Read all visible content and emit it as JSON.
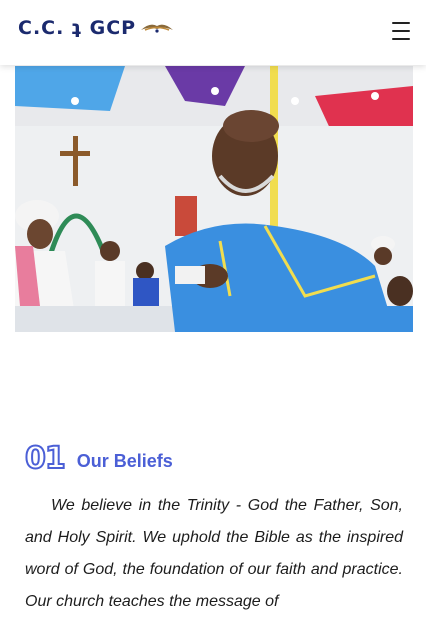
{
  "header": {
    "logo_text": "C.C. ʇ GCP",
    "logo_icon": "dove-icon",
    "menu_icon": "hamburger-menu-icon"
  },
  "hero": {
    "image": "church-congregation-photo"
  },
  "beliefs": {
    "number": "01",
    "title": "Our Beliefs",
    "body": "We believe in the Trinity - God the Father, Son, and Holy Spirit. We uphold the Bible as the inspired word of God, the foundation of our faith and practice. Our church teaches the message of"
  },
  "colors": {
    "accent": "#4b5fd6",
    "logo": "#1b2a6e"
  }
}
